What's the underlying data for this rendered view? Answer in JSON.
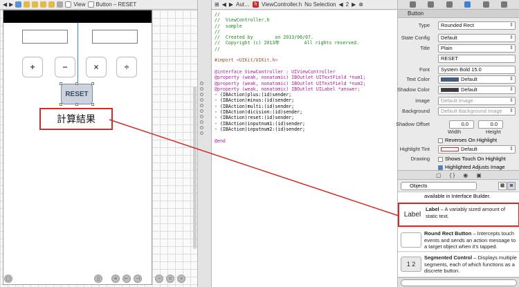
{
  "ib_jump_bar": {
    "crumbs": [
      "View",
      "Button – RESET"
    ]
  },
  "canvas": {
    "buttons": [
      {
        "label": "+",
        "name": "plus-button"
      },
      {
        "label": "−",
        "name": "minus-button"
      },
      {
        "label": "×",
        "name": "multiply-button"
      },
      {
        "label": "÷",
        "name": "divide-button"
      }
    ],
    "reset_label": "RESET",
    "result_label": "計算結果"
  },
  "editor_jump_bar": {
    "crumbs": [
      "Aut…",
      "ViewController.h",
      "No Selection"
    ],
    "counter": "2"
  },
  "code_lines": [
    {
      "text": "//",
      "cls": "c-comment"
    },
    {
      "text": "//  ViewController.h",
      "cls": "c-comment"
    },
    {
      "text": "//  sample",
      "cls": "c-comment"
    },
    {
      "text": "//",
      "cls": "c-comment"
    },
    {
      "text": "//  Created by        on 2013/06/07.",
      "cls": "c-comment"
    },
    {
      "text": "//  Copyright (c) 2013年         All rights reserved.",
      "cls": "c-comment"
    },
    {
      "text": "//",
      "cls": "c-comment"
    },
    {
      "text": "",
      "cls": "c-plain"
    },
    {
      "text": "#import <UIKit/UIKit.h>",
      "cls": "c-directive"
    },
    {
      "text": "",
      "cls": "c-plain"
    },
    {
      "text": "@interface ViewController : UIViewController",
      "cls": "c-kw"
    },
    {
      "text": "@property (weak, nonatomic) IBOutlet UITextField *num1;",
      "cls": "c-kw"
    },
    {
      "text": "@property (weak, nonatomic) IBOutlet UITextField *num2;",
      "cls": "c-kw"
    },
    {
      "text": "@property (weak, nonatomic) IBOutlet UILabel *answer;",
      "cls": "c-kw"
    },
    {
      "text": "- (IBAction)plus:(id)sender;",
      "cls": "c-plain"
    },
    {
      "text": "- (IBAction)minus:(id)sender;",
      "cls": "c-plain"
    },
    {
      "text": "- (IBAction)multi:(id)sender;",
      "cls": "c-plain"
    },
    {
      "text": "- (IBAction)dicision:(id)sender;",
      "cls": "c-plain"
    },
    {
      "text": "- (IBAction)reset:(id)sender;",
      "cls": "c-plain"
    },
    {
      "text": "- (IBAction)inputnum1:(id)sender;",
      "cls": "c-plain"
    },
    {
      "text": "- (IBAction)inputnum2:(id)sender;",
      "cls": "c-plain"
    },
    {
      "text": "",
      "cls": "c-plain"
    },
    {
      "text": "@end",
      "cls": "c-kw"
    }
  ],
  "inspector": {
    "section": "Button",
    "type": {
      "label": "Type",
      "value": "Rounded Rect"
    },
    "state_config": {
      "label": "State Config",
      "value": "Default"
    },
    "title_kind": {
      "label": "Title",
      "value": "Plain"
    },
    "title_text": "RESET",
    "font": {
      "label": "Font",
      "value": "System Bold 15.0"
    },
    "text_color": {
      "label": "Text Color",
      "value": "Default"
    },
    "shadow_color": {
      "label": "Shadow Color",
      "value": "Default"
    },
    "image": {
      "label": "Image",
      "placeholder": "Default Image"
    },
    "background": {
      "label": "Background",
      "placeholder": "Default Background Image"
    },
    "shadow_offset": {
      "label": "Shadow Offset",
      "width": "0.0",
      "height": "0.0",
      "width_label": "Width",
      "height_label": "Height"
    },
    "reverses": "Reverses On Highlight",
    "highlight_tint": {
      "label": "Highlight Tint",
      "value": "Default"
    },
    "drawing": {
      "label": "Drawing",
      "value": "Shows Touch On Highlight"
    },
    "adjusts": "Highlighted Adjusts Image"
  },
  "library": {
    "filter": "Objects",
    "top_text": "available in Interface Builder.",
    "items": [
      {
        "thumb": "Label",
        "title": "Label",
        "desc": " – A variably sized amount of static text."
      },
      {
        "thumb": "",
        "title": "Round Rect Button",
        "desc": " – Intercepts touch events and sends an action message to a target object when it's tapped."
      },
      {
        "thumb": "1 2",
        "title": "Segmented Control",
        "desc": " – Displays multiple segments, each of which functions as a discrete button."
      }
    ]
  },
  "colors": {
    "annotation": "#d12a2a",
    "guide": "#3f7fd7"
  }
}
